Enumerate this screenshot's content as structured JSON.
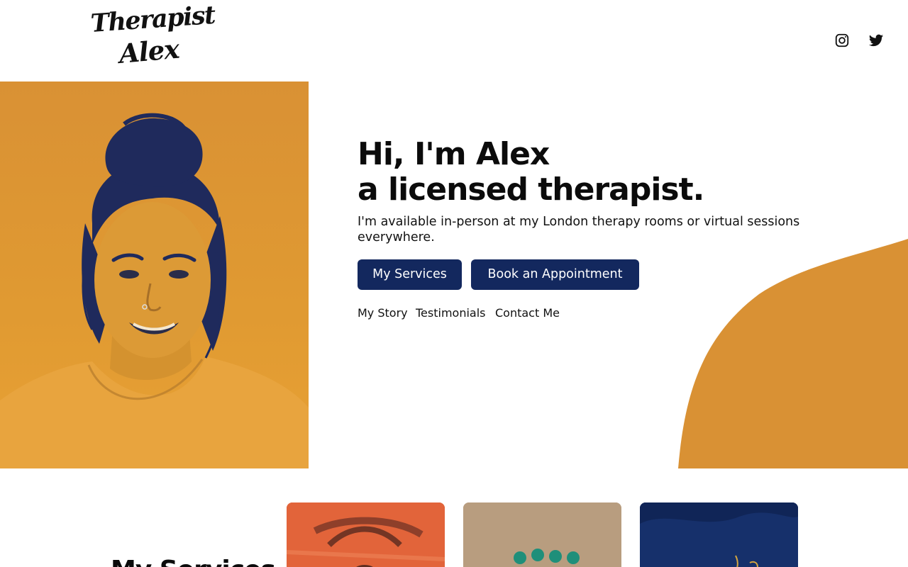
{
  "brand": {
    "logo_line1": "Therapist",
    "logo_line2": "Alex"
  },
  "social": {
    "instagram": "instagram-icon",
    "twitter": "twitter-icon"
  },
  "hero": {
    "title_line1": "Hi, I'm Alex",
    "title_line2": "a licensed therapist.",
    "subtitle": "I'm available in-person at my London therapy rooms or virtual sessions everywhere.",
    "primary_button": "My Services",
    "secondary_button": "Book an Appointment",
    "links": [
      "My Story",
      "Testimonials",
      "Contact Me"
    ]
  },
  "services": {
    "heading": "My Services"
  },
  "colors": {
    "accent": "#d99134",
    "button": "#13285e",
    "text": "#111111"
  }
}
